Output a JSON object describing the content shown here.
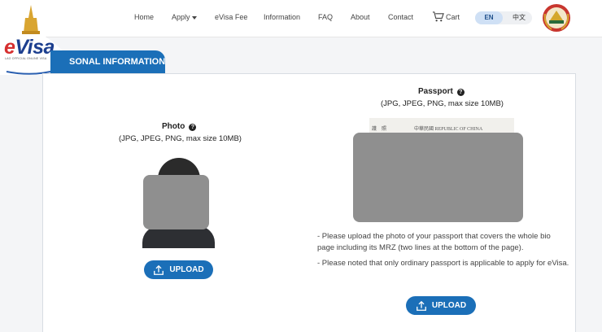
{
  "nav": {
    "home": "Home",
    "apply": "Apply",
    "fee": "eVisa Fee",
    "information": "Information",
    "faq": "FAQ",
    "about": "About",
    "contact": "Contact",
    "cart": "Cart"
  },
  "lang": {
    "en": "EN",
    "zh": "中文"
  },
  "logo": {
    "text_e": "e",
    "text_visa": "Visa",
    "subtitle": "LAO OFFICIAL ONLINE VISA"
  },
  "section": {
    "title": "SONAL INFORMATION"
  },
  "photo": {
    "title": "Photo",
    "help": "?",
    "subtitle": "(JPG, JPEG, PNG, max size 10MB)",
    "upload_label": "UPLOAD"
  },
  "passport": {
    "title": "Passport",
    "help": "?",
    "subtitle": "(JPG, JPEG, PNG, max size 10MB)",
    "strip_left": "護　照",
    "strip_right": "中華民國 REPUBLIC OF CHINA",
    "note_1": "- Please upload the photo of your passport that covers the whole bio page including its MRZ (two lines at the bottom of the page).",
    "note_2": "- Please noted that only ordinary passport is applicable to apply for eVisa.",
    "upload_label": "UPLOAD"
  },
  "colors": {
    "primary": "#1b6fb8",
    "brand_blue": "#1d3f8f",
    "brand_red": "#d62f2f"
  }
}
